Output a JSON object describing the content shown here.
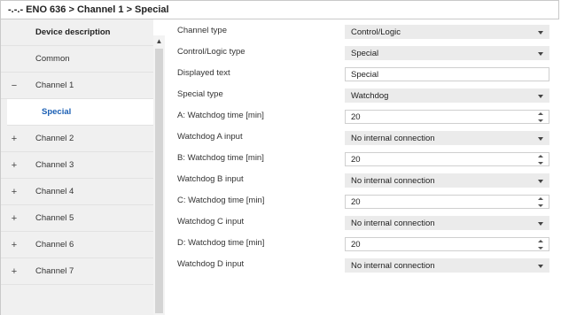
{
  "breadcrumb": "-.-.- ENO 636 > Channel 1 > Special",
  "sidebar": {
    "items": [
      {
        "expander": "",
        "label": "Device description"
      },
      {
        "expander": "",
        "label": "Common"
      },
      {
        "expander": "−",
        "label": "Channel 1"
      },
      {
        "expander": "",
        "label": "Special"
      },
      {
        "expander": "+",
        "label": "Channel 2"
      },
      {
        "expander": "+",
        "label": "Channel 3"
      },
      {
        "expander": "+",
        "label": "Channel 4"
      },
      {
        "expander": "+",
        "label": "Channel 5"
      },
      {
        "expander": "+",
        "label": "Channel 6"
      },
      {
        "expander": "+",
        "label": "Channel 7"
      }
    ]
  },
  "params": [
    {
      "label": "Channel type",
      "value": "Control/Logic",
      "control": "dropdown"
    },
    {
      "label": "Control/Logic type",
      "value": "Special",
      "control": "dropdown"
    },
    {
      "label": "Displayed text",
      "value": "Special",
      "control": "text"
    },
    {
      "label": "Special type",
      "value": "Watchdog",
      "control": "dropdown"
    },
    {
      "label": "A: Watchdog time [min]",
      "value": "20",
      "control": "spinner"
    },
    {
      "label": "Watchdog A input",
      "value": "No internal connection",
      "control": "dropdown"
    },
    {
      "label": "B: Watchdog time [min]",
      "value": "20",
      "control": "spinner"
    },
    {
      "label": "Watchdog B input",
      "value": "No internal connection",
      "control": "dropdown"
    },
    {
      "label": "C: Watchdog time [min]",
      "value": "20",
      "control": "spinner"
    },
    {
      "label": "Watchdog C input",
      "value": "No internal connection",
      "control": "dropdown"
    },
    {
      "label": "D: Watchdog time [min]",
      "value": "20",
      "control": "spinner"
    },
    {
      "label": "Watchdog D input",
      "value": "No internal connection",
      "control": "dropdown"
    }
  ]
}
